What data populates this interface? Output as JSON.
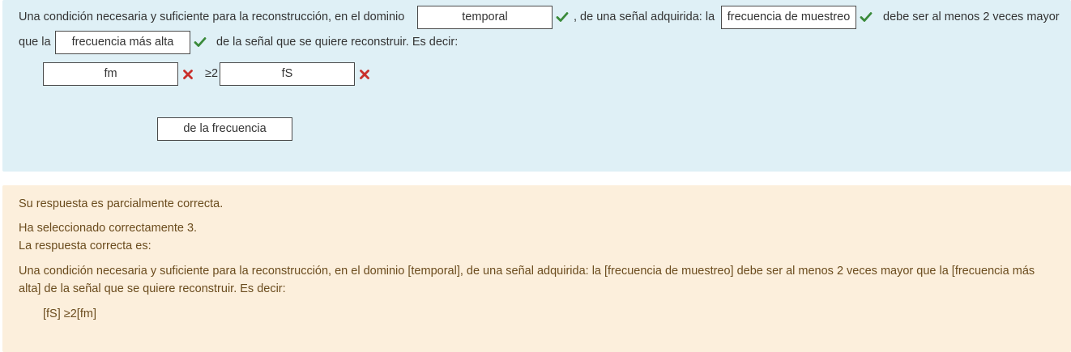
{
  "question": {
    "sentence_1_part_1": "Una condición necesaria y suficiente para la reconstrucción, en el dominio",
    "sentence_1_part_2": ", de una señal adquirida: la",
    "sentence_1_part_3": "debe ser al menos 2 veces mayor",
    "sentence_2_part_1": "que la",
    "sentence_2_part_2": "de la señal que se quiere reconstruir. Es decir:",
    "inequality_symbol": "≥2",
    "blanks": {
      "domain": "temporal",
      "sampling": "frecuencia de muestreo",
      "highest": "frecuencia más alta",
      "formula_left": "fm",
      "formula_right": "fS",
      "unused": "de la frecuencia"
    },
    "status": {
      "domain": "correct",
      "sampling": "correct",
      "highest": "correct",
      "formula_left": "incorrect",
      "formula_right": "incorrect"
    },
    "colors": {
      "correct": "#3a8a3a",
      "incorrect": "#c9302c"
    }
  },
  "feedback": {
    "partial": "Su respuesta es parcialmente correcta.",
    "selected_correctly": "Ha seleccionado correctamente 3.",
    "correct_answer_label": "La respuesta correcta es:",
    "correct_answer_line_1": "Una condición necesaria y suficiente para la reconstrucción, en el dominio [temporal], de una señal adquirida: la [frecuencia de muestreo] debe ser al menos 2 veces mayor que la [frecuencia más",
    "correct_answer_line_2": "alta] de la señal que se quiere reconstruir. Es decir:",
    "correct_formula": "[fS] ≥2[fm]"
  }
}
